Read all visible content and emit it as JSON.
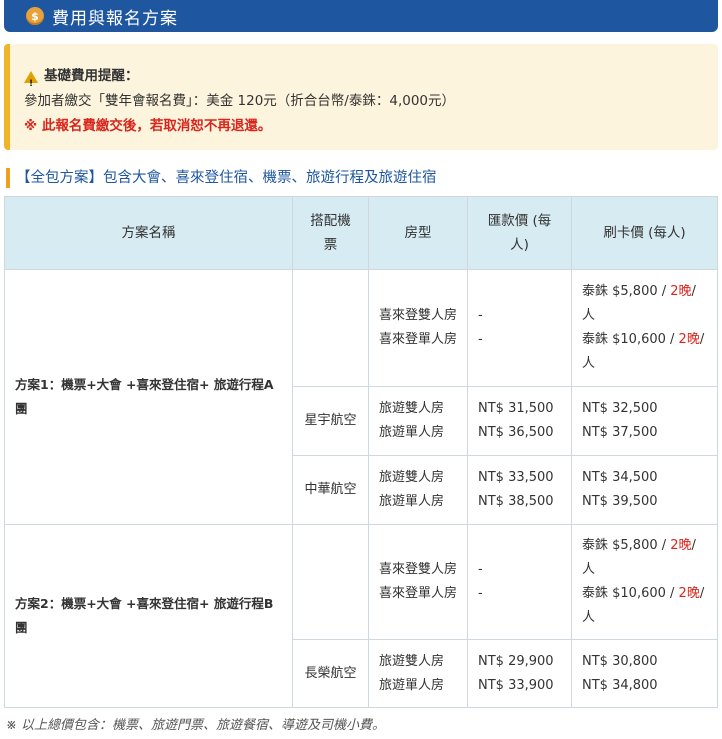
{
  "header": {
    "icon": "money-bag-icon",
    "title": "費用與報名方案"
  },
  "notice": {
    "title": "基礎費用提醒：",
    "fee_text": "參加者繳交「雙年會報名費」：美金 120元（折合台幣/泰銖：4,000元）",
    "warning": "※ 此報名費繳交後，若取消恕不再退還。"
  },
  "section": {
    "title": "【全包方案】包含大會、喜來登住宿、機票、旅遊行程及旅遊住宿"
  },
  "table": {
    "headers": [
      "方案名稱",
      "搭配機票",
      "房型",
      "匯款價 (每人)",
      "刷卡價 (每人)"
    ],
    "plans": [
      {
        "name": "方案1：機票+大會 +喜來登住宿+ 旅遊行程A團",
        "sheraton": {
          "rooms": [
            "喜來登雙人房",
            "喜來登單人房"
          ],
          "transfer": [
            "-",
            "-"
          ],
          "card": [
            {
              "prefix": "泰銖 $5,800 / ",
              "nights": "2晚",
              "suffix": "/人"
            },
            {
              "prefix": "泰銖 $10,600 / ",
              "nights": "2晚",
              "suffix": "/人"
            }
          ]
        },
        "airlines": [
          {
            "airline": "星宇航空",
            "rooms": [
              "旅遊雙人房",
              "旅遊單人房"
            ],
            "transfer": [
              "NT$ 31,500",
              "NT$ 36,500"
            ],
            "card": [
              "NT$ 32,500",
              "NT$ 37,500"
            ]
          },
          {
            "airline": "中華航空",
            "rooms": [
              "旅遊雙人房",
              "旅遊單人房"
            ],
            "transfer": [
              "NT$ 33,500",
              "NT$ 38,500"
            ],
            "card": [
              "NT$ 34,500",
              "NT$ 39,500"
            ]
          }
        ]
      },
      {
        "name": "方案2：機票+大會 +喜來登住宿+ 旅遊行程B團",
        "sheraton": {
          "rooms": [
            "喜來登雙人房",
            "喜來登單人房"
          ],
          "transfer": [
            "-",
            "-"
          ],
          "card": [
            {
              "prefix": "泰銖 $5,800 / ",
              "nights": "2晚",
              "suffix": "/人"
            },
            {
              "prefix": "泰銖 $10,600 / ",
              "nights": "2晚",
              "suffix": "/人"
            }
          ]
        },
        "airlines": [
          {
            "airline": "長榮航空",
            "rooms": [
              "旅遊雙人房",
              "旅遊單人房"
            ],
            "transfer": [
              "NT$ 29,900",
              "NT$ 33,900"
            ],
            "card": [
              "NT$ 30,800",
              "NT$ 34,800"
            ]
          }
        ]
      }
    ]
  },
  "footnote": "※ 以上總價包含：機票、旅遊門票、旅遊餐宿、導遊及司機小費。"
}
